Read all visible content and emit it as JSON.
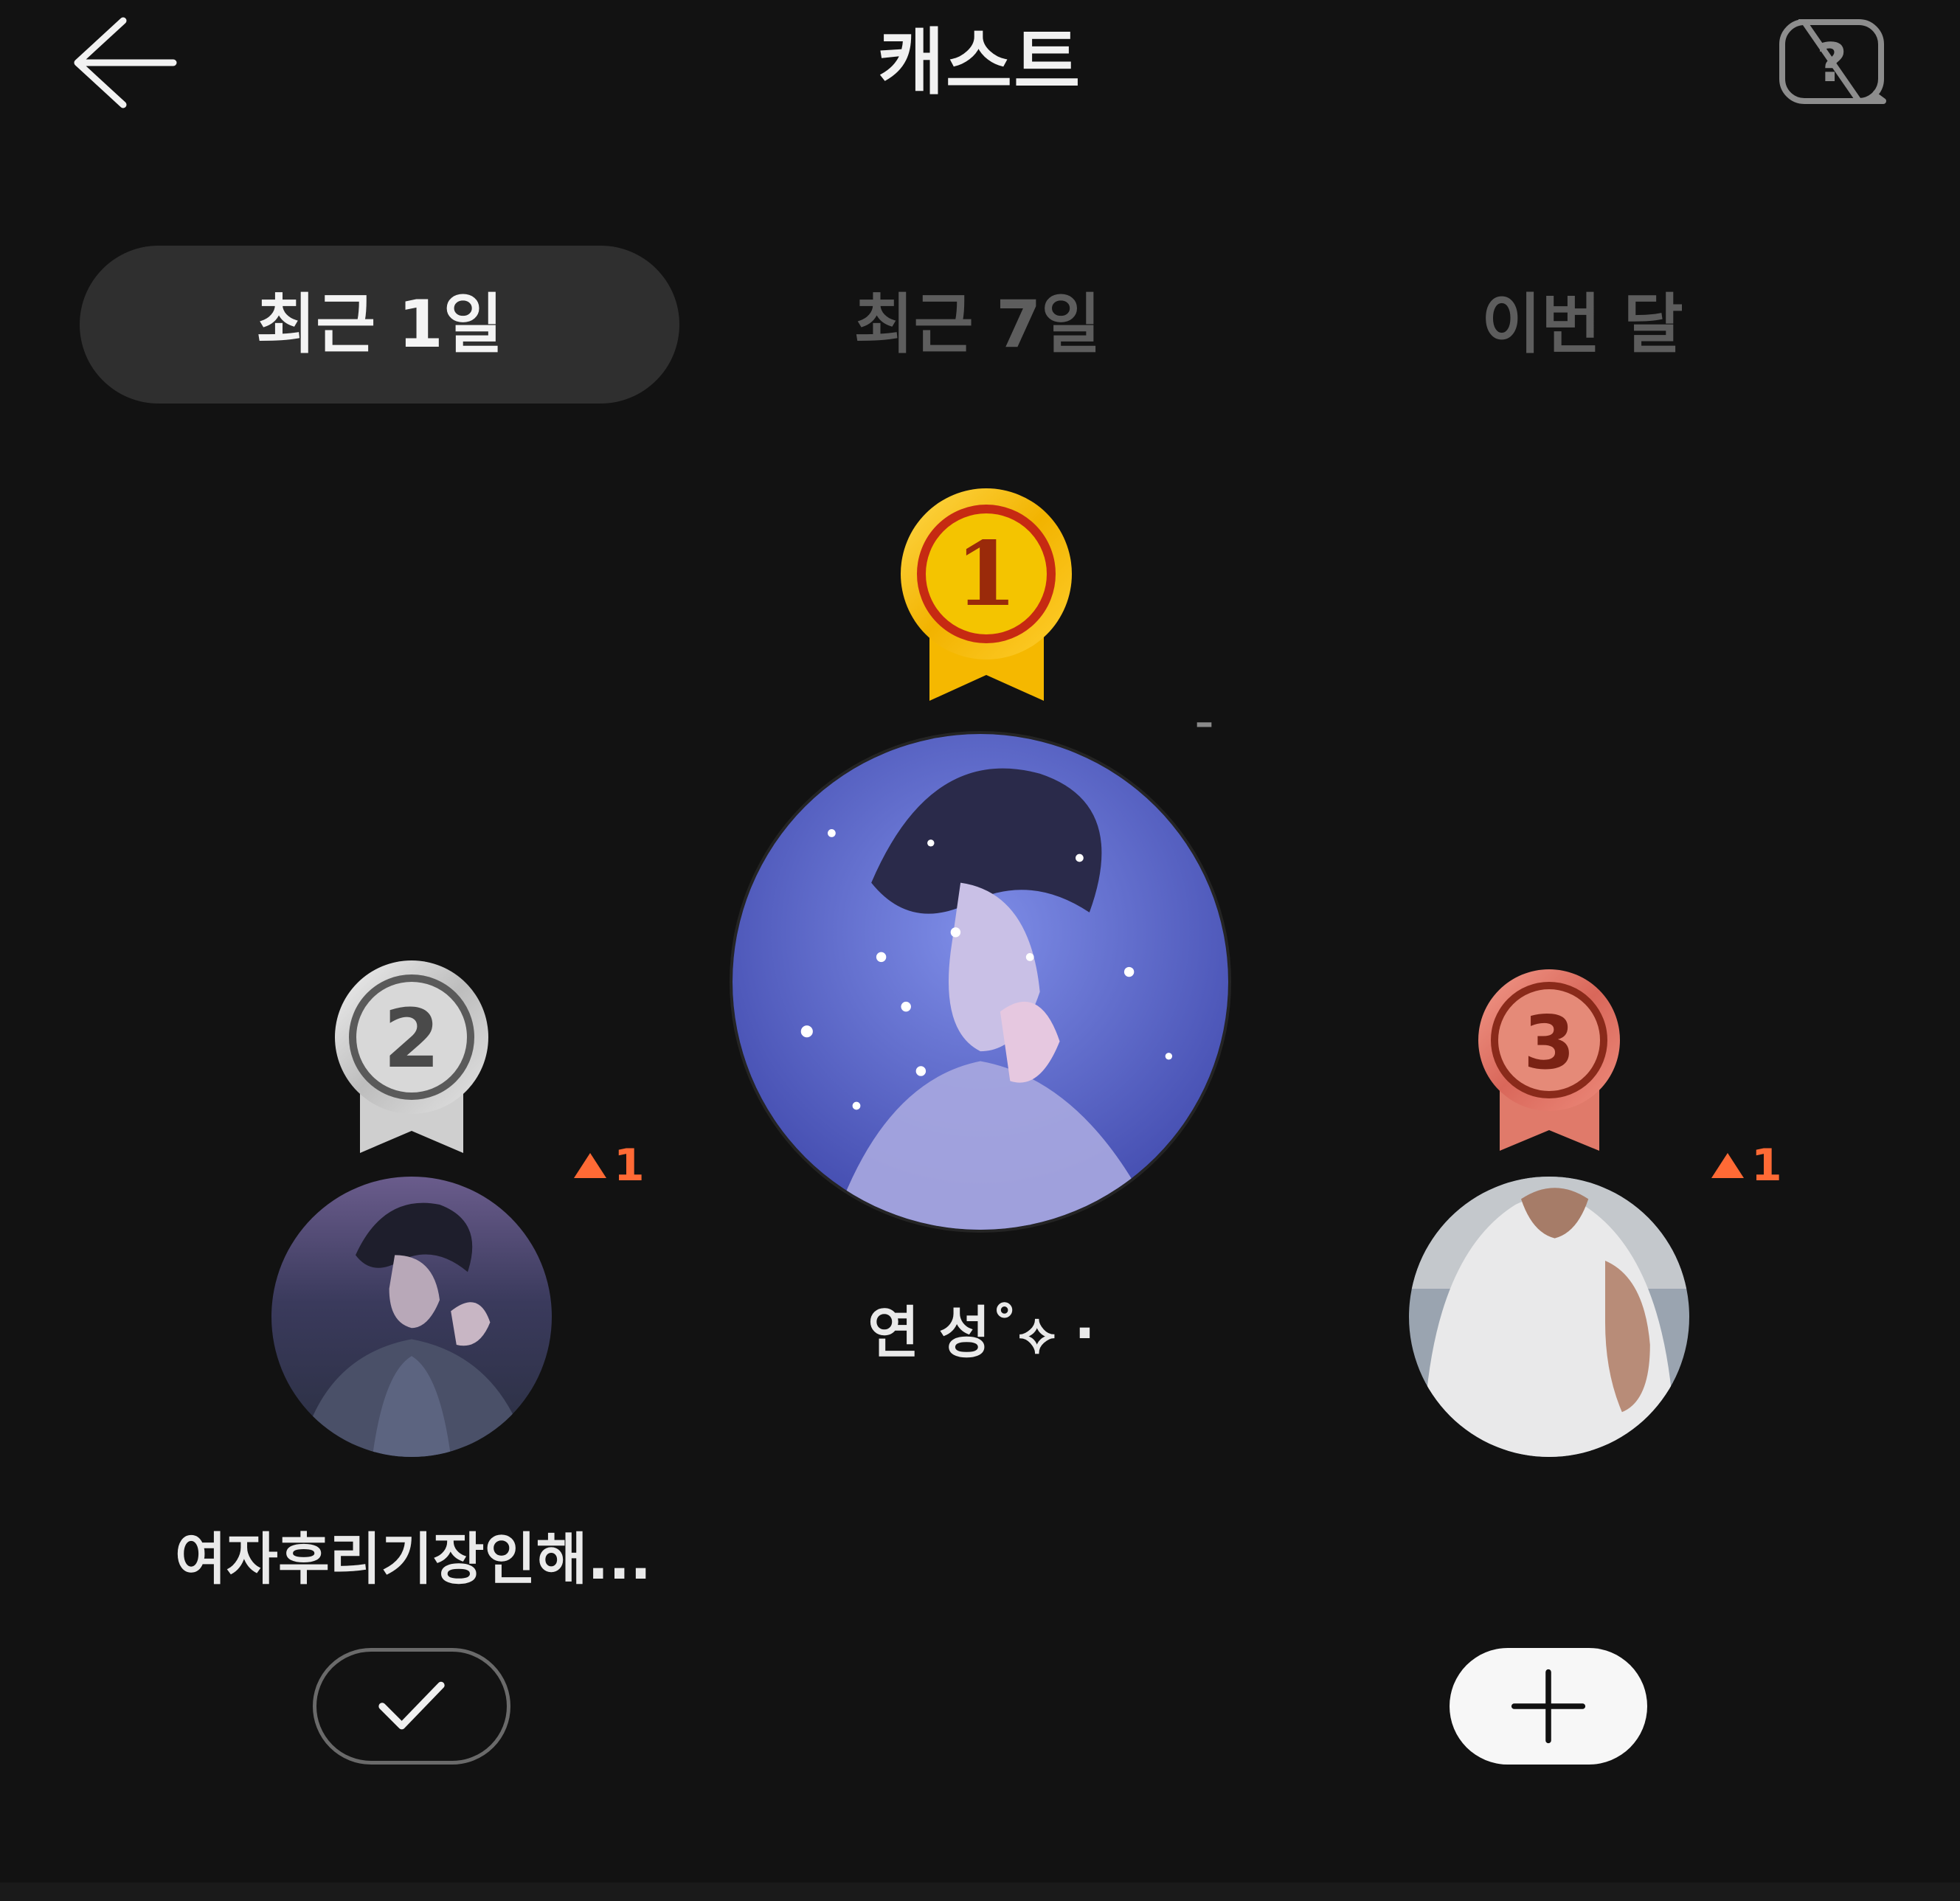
{
  "header": {
    "title": "캐스트",
    "back_icon": "arrow-left-icon",
    "help_icon": "help-bubble-icon"
  },
  "tabs": [
    {
      "label": "최근 1일",
      "active": true
    },
    {
      "label": "최근 7일",
      "active": false
    },
    {
      "label": "이번 달",
      "active": false
    }
  ],
  "ranking": [
    {
      "rank": "1",
      "name": "연 성˚⟡ ‧",
      "change": "–",
      "change_dir": "none",
      "followed": null
    },
    {
      "rank": "2",
      "name": "여자후리기장인해...",
      "change": "1",
      "change_dir": "up",
      "followed": true
    },
    {
      "rank": "3",
      "name": "",
      "change": "1",
      "change_dir": "up",
      "followed": false
    }
  ],
  "colors": {
    "background": "#121212",
    "tab_active_bg": "#2f2f2f",
    "tab_inactive_text": "#5d5d5d",
    "rank_up": "#ff6a35",
    "gold": "#f5b800",
    "silver": "#c9c9c9",
    "bronze": "#e07a6a"
  }
}
